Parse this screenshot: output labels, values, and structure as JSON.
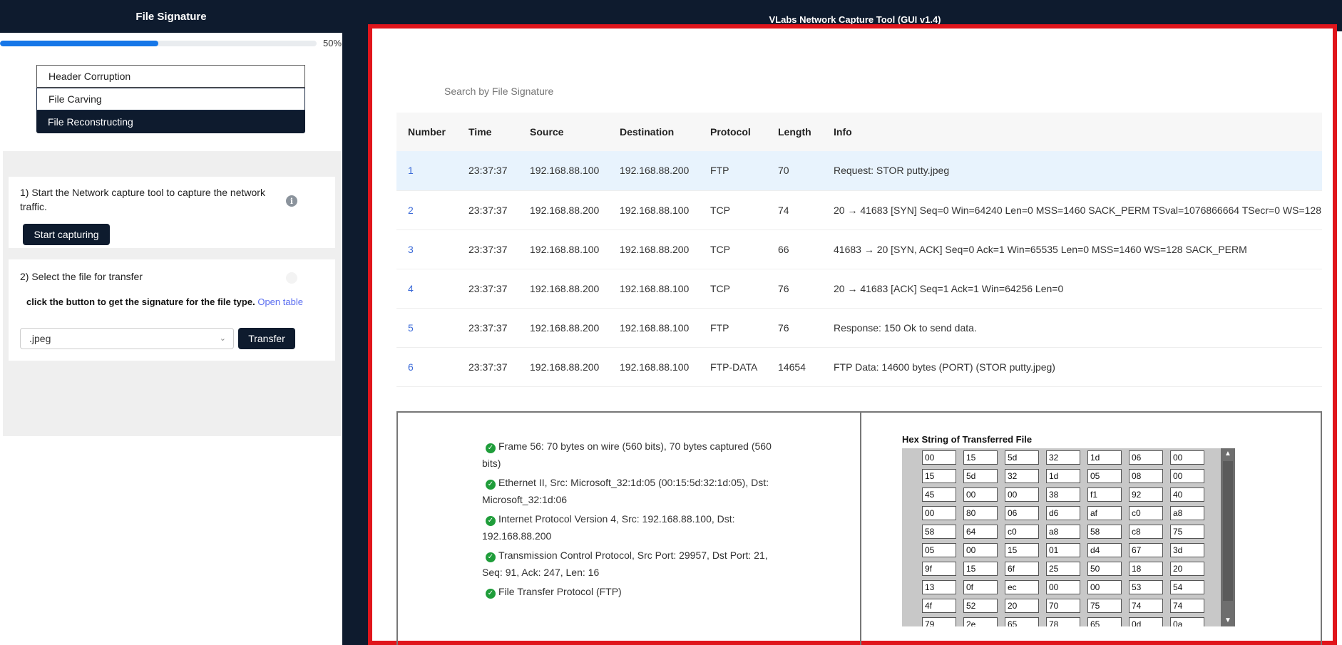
{
  "left_panel": {
    "title": "File Signature",
    "progress": {
      "percent": 50,
      "text": "50%"
    },
    "menu": [
      {
        "label": "Header Corruption"
      },
      {
        "label": "File Carving"
      },
      {
        "label": "File Reconstructing"
      }
    ],
    "step1": {
      "title": "1) Start the Network capture tool to capture the network traffic.",
      "button": "Start capturing"
    },
    "step2": {
      "title": "2) Select the file for transfer",
      "hint": "click the button to get the signature for the file type.",
      "link": "Open table",
      "select_value": ".jpeg",
      "button": "Transfer"
    }
  },
  "right_panel": {
    "title": "VLabs Network Capture Tool (GUI v1.4)",
    "search_placeholder": "Search by File Signature",
    "columns": [
      "Number",
      "Time",
      "Source",
      "Destination",
      "Protocol",
      "Length",
      "Info"
    ],
    "rows": [
      [
        "1",
        "23:37:37",
        "192.168.88.100",
        "192.168.88.200",
        "FTP",
        "70",
        "Request: STOR putty.jpeg"
      ],
      [
        "2",
        "23:37:37",
        "192.168.88.200",
        "192.168.88.100",
        "TCP",
        "74",
        "20 → 41683 [SYN] Seq=0 Win=64240 Len=0 MSS=1460 SACK_PERM TSval=1076866664 TSecr=0 WS=128"
      ],
      [
        "3",
        "23:37:37",
        "192.168.88.100",
        "192.168.88.200",
        "TCP",
        "66",
        "41683 → 20 [SYN, ACK] Seq=0 Ack=1 Win=65535 Len=0 MSS=1460 WS=128 SACK_PERM"
      ],
      [
        "4",
        "23:37:37",
        "192.168.88.200",
        "192.168.88.100",
        "TCP",
        "76",
        "20 → 41683 [ACK] Seq=1 Ack=1 Win=64256 Len=0"
      ],
      [
        "5",
        "23:37:37",
        "192.168.88.200",
        "192.168.88.100",
        "FTP",
        "76",
        "Response: 150 Ok to send data."
      ],
      [
        "6",
        "23:37:37",
        "192.168.88.200",
        "192.168.88.100",
        "FTP-DATA",
        "14654",
        "FTP Data: 14600 bytes (PORT) (STOR putty.jpeg)"
      ]
    ],
    "detail_tree": [
      "Frame 56: 70 bytes on wire (560 bits), 70 bytes captured (560 bits)",
      "Ethernet II, Src: Microsoft_32:1d:05 (00:15:5d:32:1d:05), Dst: Microsoft_32:1d:06",
      "Internet Protocol Version 4, Src: 192.168.88.100, Dst: 192.168.88.200",
      "Transmission Control Protocol, Src Port: 29957, Dst Port: 21, Seq: 91, Ack: 247, Len: 16",
      "File Transfer Protocol (FTP)"
    ],
    "hex_title": "Hex String of Transferred File",
    "hex_values": [
      "00",
      "15",
      "5d",
      "32",
      "1d",
      "06",
      "00",
      "15",
      "5d",
      "32",
      "1d",
      "05",
      "08",
      "00",
      "45",
      "00",
      "00",
      "38",
      "f1",
      "92",
      "40",
      "00",
      "80",
      "06",
      "d6",
      "af",
      "c0",
      "a8",
      "58",
      "64",
      "c0",
      "a8",
      "58",
      "c8",
      "75",
      "05",
      "00",
      "15",
      "01",
      "d4",
      "67",
      "3d",
      "9f",
      "15",
      "6f",
      "25",
      "50",
      "18",
      "20",
      "13",
      "0f",
      "ec",
      "00",
      "00",
      "53",
      "54",
      "4f",
      "52",
      "20",
      "70",
      "75",
      "74",
      "74",
      "79",
      "2e",
      "65",
      "78",
      "65",
      "0d",
      "0a"
    ]
  },
  "colors": {
    "navy": "#0e1b2e",
    "accent_blue": "#1677e8",
    "frame_red": "#e0151b",
    "check_green": "#1f9d3a"
  }
}
